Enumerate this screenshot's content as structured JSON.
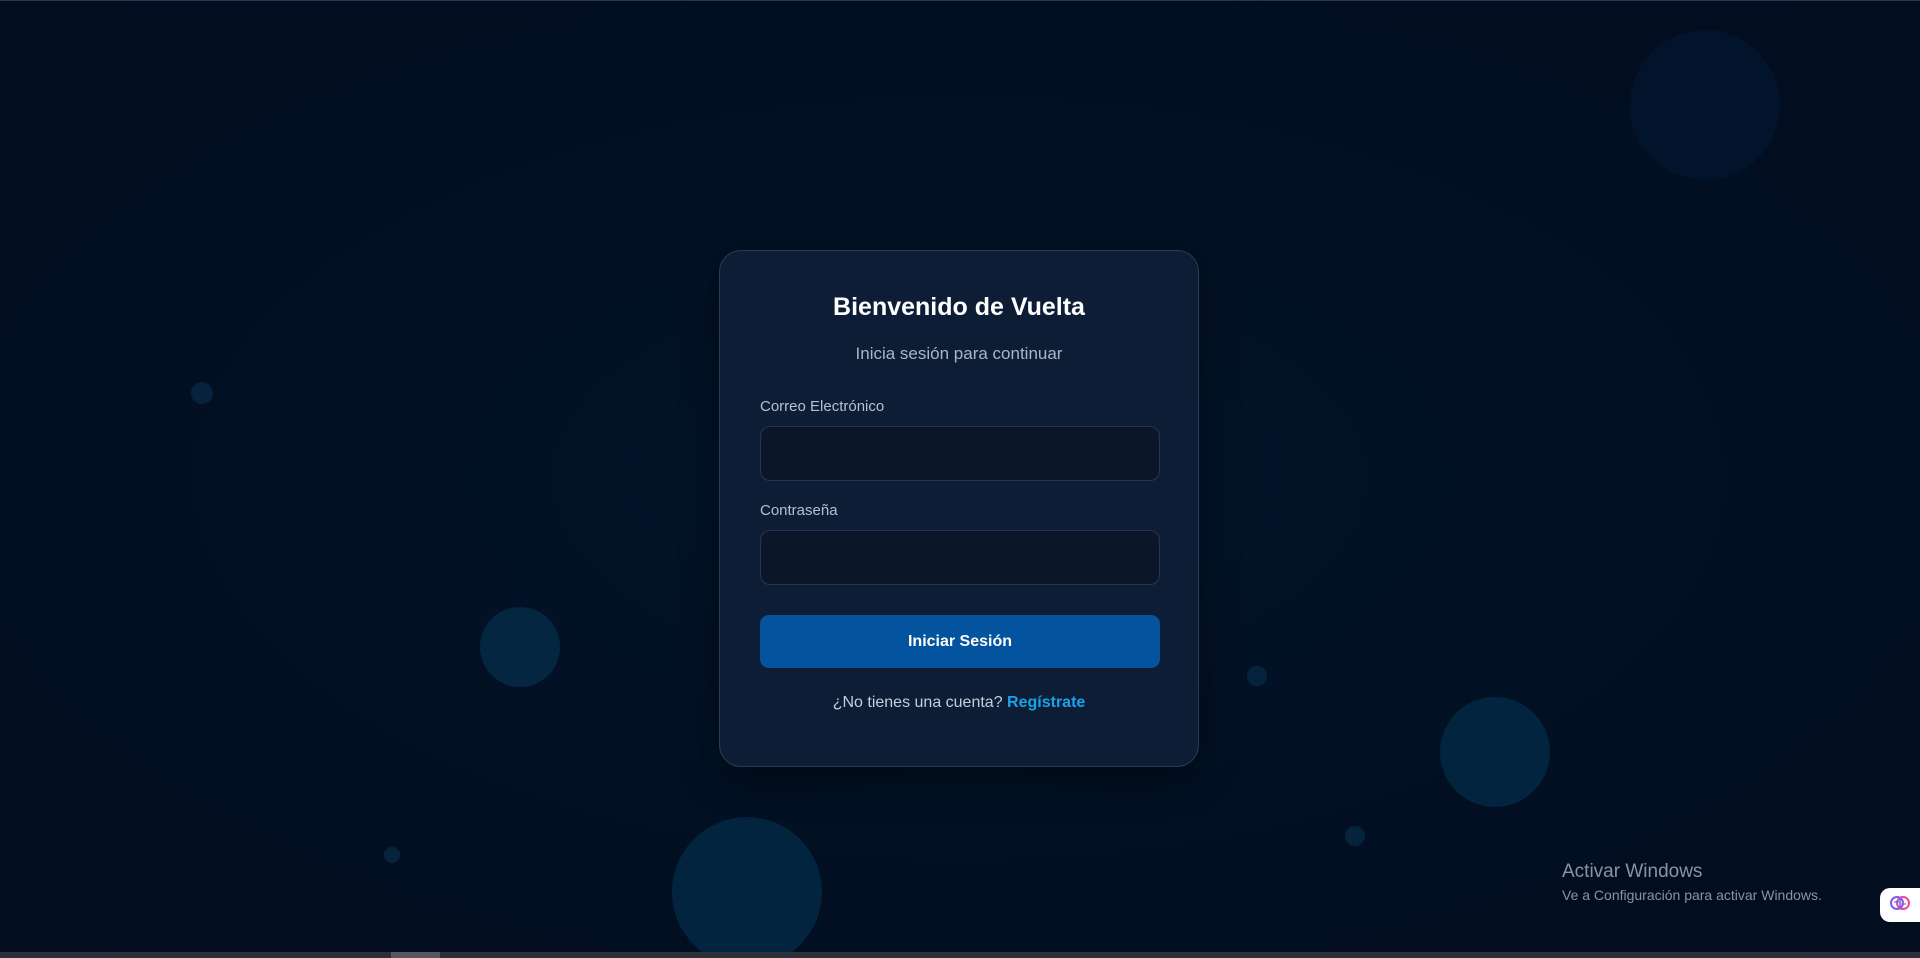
{
  "login": {
    "title": "Bienvenido de Vuelta",
    "subtitle": "Inicia sesión para continuar",
    "email_label": "Correo Electrónico",
    "email_value": "",
    "password_label": "Contraseña",
    "password_value": "",
    "submit_label": "Iniciar Sesión",
    "register_prompt": "¿No tienes una cuenta?",
    "register_link": "Regístrate"
  },
  "watermark": {
    "title": "Activar Windows",
    "subtitle": "Ve a Configuración para activar Windows."
  },
  "side_widget": {
    "icon": "brain-icon"
  },
  "colors": {
    "background": "#020f22",
    "card": "#0e1d36",
    "primary_button": "#03539e",
    "link": "#1aa3e8"
  }
}
